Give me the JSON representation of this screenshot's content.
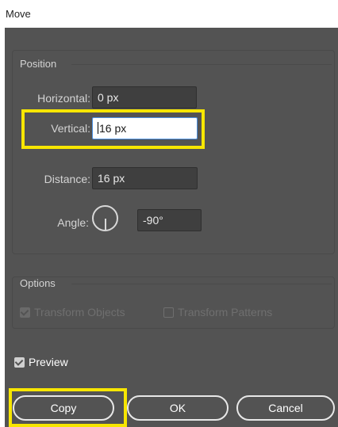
{
  "window": {
    "title": "Move"
  },
  "position": {
    "label": "Position",
    "horizontal": {
      "label": "Horizontal:",
      "value": "0 px"
    },
    "vertical": {
      "label": "Vertical:",
      "value": "16 px"
    },
    "distance": {
      "label": "Distance:",
      "value": "16 px"
    },
    "angle": {
      "label": "Angle:",
      "value": "-90°"
    }
  },
  "options": {
    "label": "Options",
    "transform_objects": {
      "label": "Transform Objects",
      "checked": true,
      "enabled": false
    },
    "transform_patterns": {
      "label": "Transform Patterns",
      "checked": false,
      "enabled": false
    }
  },
  "preview": {
    "label": "Preview",
    "checked": true
  },
  "buttons": {
    "copy": "Copy",
    "ok": "OK",
    "cancel": "Cancel"
  },
  "colors": {
    "dialog_bg": "#535353",
    "highlight": "#f7e600",
    "active_field_border": "#4a90e2"
  }
}
